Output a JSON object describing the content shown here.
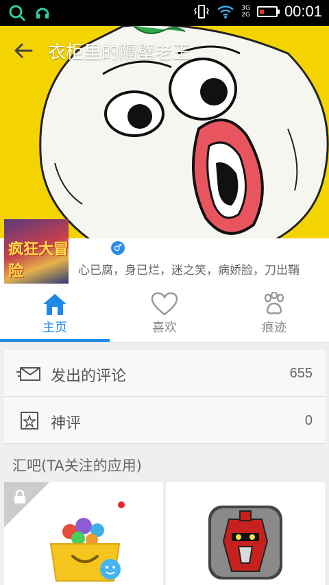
{
  "status_bar": {
    "time": "00:01",
    "net_top": "3G",
    "net_bottom": "2G"
  },
  "header": {
    "title": "衣柜里的隔壁老王"
  },
  "profile": {
    "gender_symbol": "♂",
    "motto": "心已腐，身已烂，迷之笑，病娇脸，刀出鞘",
    "avatar_text": "疯狂大冒险"
  },
  "tabs": [
    {
      "label": "主页",
      "icon": "home-icon"
    },
    {
      "label": "喜欢",
      "icon": "heart-icon"
    },
    {
      "label": "痕迹",
      "icon": "paw-icon"
    }
  ],
  "list": [
    {
      "label": "发出的评论",
      "count": "655",
      "icon": "comment-icon"
    },
    {
      "label": "神评",
      "count": "0",
      "icon": "star-icon"
    }
  ],
  "section_title": "汇吧(TA关注的应用)",
  "colors": {
    "accent": "#1e8ae6",
    "hero_bg": "#f3d300"
  }
}
